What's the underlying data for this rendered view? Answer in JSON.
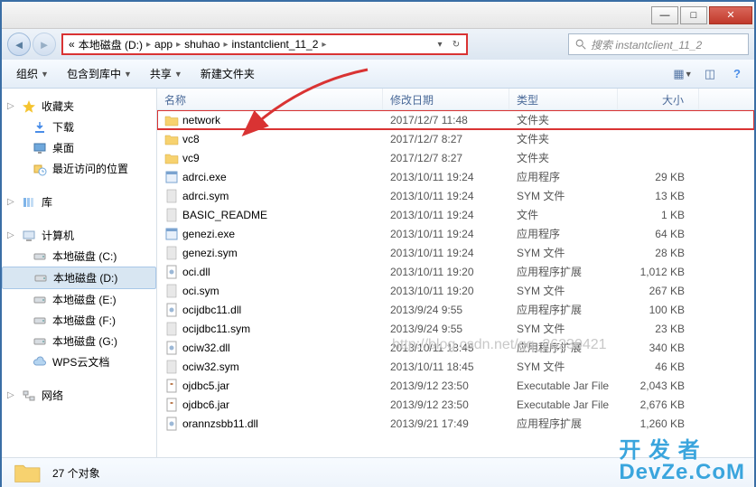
{
  "window": {
    "minimize": "—",
    "maximize": "□",
    "close": "✕"
  },
  "breadcrumb": {
    "prefix": "«",
    "parts": [
      "本地磁盘 (D:)",
      "app",
      "shuhao",
      "instantclient_11_2"
    ],
    "sep": "▸"
  },
  "search": {
    "placeholder": "搜索 instantclient_11_2"
  },
  "toolbar": {
    "organize": "组织",
    "include": "包含到库中",
    "share": "共享",
    "newfolder": "新建文件夹"
  },
  "columns": {
    "name": "名称",
    "date": "修改日期",
    "type": "类型",
    "size": "大小"
  },
  "sidebar": {
    "groups": [
      {
        "head": "收藏夹",
        "head_icon": "star",
        "items": [
          {
            "label": "下载",
            "icon": "download"
          },
          {
            "label": "桌面",
            "icon": "desktop"
          },
          {
            "label": "最近访问的位置",
            "icon": "recent"
          }
        ]
      },
      {
        "head": "库",
        "head_icon": "library",
        "items": []
      },
      {
        "head": "计算机",
        "head_icon": "computer",
        "items": [
          {
            "label": "本地磁盘 (C:)",
            "icon": "drive"
          },
          {
            "label": "本地磁盘 (D:)",
            "icon": "drive",
            "selected": true
          },
          {
            "label": "本地磁盘 (E:)",
            "icon": "drive"
          },
          {
            "label": "本地磁盘 (F:)",
            "icon": "drive"
          },
          {
            "label": "本地磁盘 (G:)",
            "icon": "drive"
          },
          {
            "label": "WPS云文档",
            "icon": "cloud"
          }
        ]
      },
      {
        "head": "网络",
        "head_icon": "network",
        "items": []
      }
    ]
  },
  "files": [
    {
      "name": "network",
      "date": "2017/12/7 11:48",
      "type": "文件夹",
      "size": "",
      "icon": "folder",
      "highlighted": true
    },
    {
      "name": "vc8",
      "date": "2017/12/7 8:27",
      "type": "文件夹",
      "size": "",
      "icon": "folder"
    },
    {
      "name": "vc9",
      "date": "2017/12/7 8:27",
      "type": "文件夹",
      "size": "",
      "icon": "folder"
    },
    {
      "name": "adrci.exe",
      "date": "2013/10/11 19:24",
      "type": "应用程序",
      "size": "29 KB",
      "icon": "exe"
    },
    {
      "name": "adrci.sym",
      "date": "2013/10/11 19:24",
      "type": "SYM 文件",
      "size": "13 KB",
      "icon": "file"
    },
    {
      "name": "BASIC_README",
      "date": "2013/10/11 19:24",
      "type": "文件",
      "size": "1 KB",
      "icon": "file"
    },
    {
      "name": "genezi.exe",
      "date": "2013/10/11 19:24",
      "type": "应用程序",
      "size": "64 KB",
      "icon": "exe"
    },
    {
      "name": "genezi.sym",
      "date": "2013/10/11 19:24",
      "type": "SYM 文件",
      "size": "28 KB",
      "icon": "file"
    },
    {
      "name": "oci.dll",
      "date": "2013/10/11 19:20",
      "type": "应用程序扩展",
      "size": "1,012 KB",
      "icon": "dll"
    },
    {
      "name": "oci.sym",
      "date": "2013/10/11 19:20",
      "type": "SYM 文件",
      "size": "267 KB",
      "icon": "file"
    },
    {
      "name": "ocijdbc11.dll",
      "date": "2013/9/24 9:55",
      "type": "应用程序扩展",
      "size": "100 KB",
      "icon": "dll"
    },
    {
      "name": "ocijdbc11.sym",
      "date": "2013/9/24 9:55",
      "type": "SYM 文件",
      "size": "23 KB",
      "icon": "file"
    },
    {
      "name": "ociw32.dll",
      "date": "2013/10/11 18:45",
      "type": "应用程序扩展",
      "size": "340 KB",
      "icon": "dll"
    },
    {
      "name": "ociw32.sym",
      "date": "2013/10/11 18:45",
      "type": "SYM 文件",
      "size": "46 KB",
      "icon": "file"
    },
    {
      "name": "ojdbc5.jar",
      "date": "2013/9/12 23:50",
      "type": "Executable Jar File",
      "size": "2,043 KB",
      "icon": "jar"
    },
    {
      "name": "ojdbc6.jar",
      "date": "2013/9/12 23:50",
      "type": "Executable Jar File",
      "size": "2,676 KB",
      "icon": "jar"
    },
    {
      "name": "orannzsbb11.dll",
      "date": "2013/9/21 17:49",
      "type": "应用程序扩展",
      "size": "1,260 KB",
      "icon": "dll"
    }
  ],
  "status": {
    "count": "27 个对象"
  },
  "watermark": "http://blog.csdn.net/qq_26230421",
  "brand": {
    "l1": "开 发 者",
    "l2": "DevZe.CoM"
  }
}
